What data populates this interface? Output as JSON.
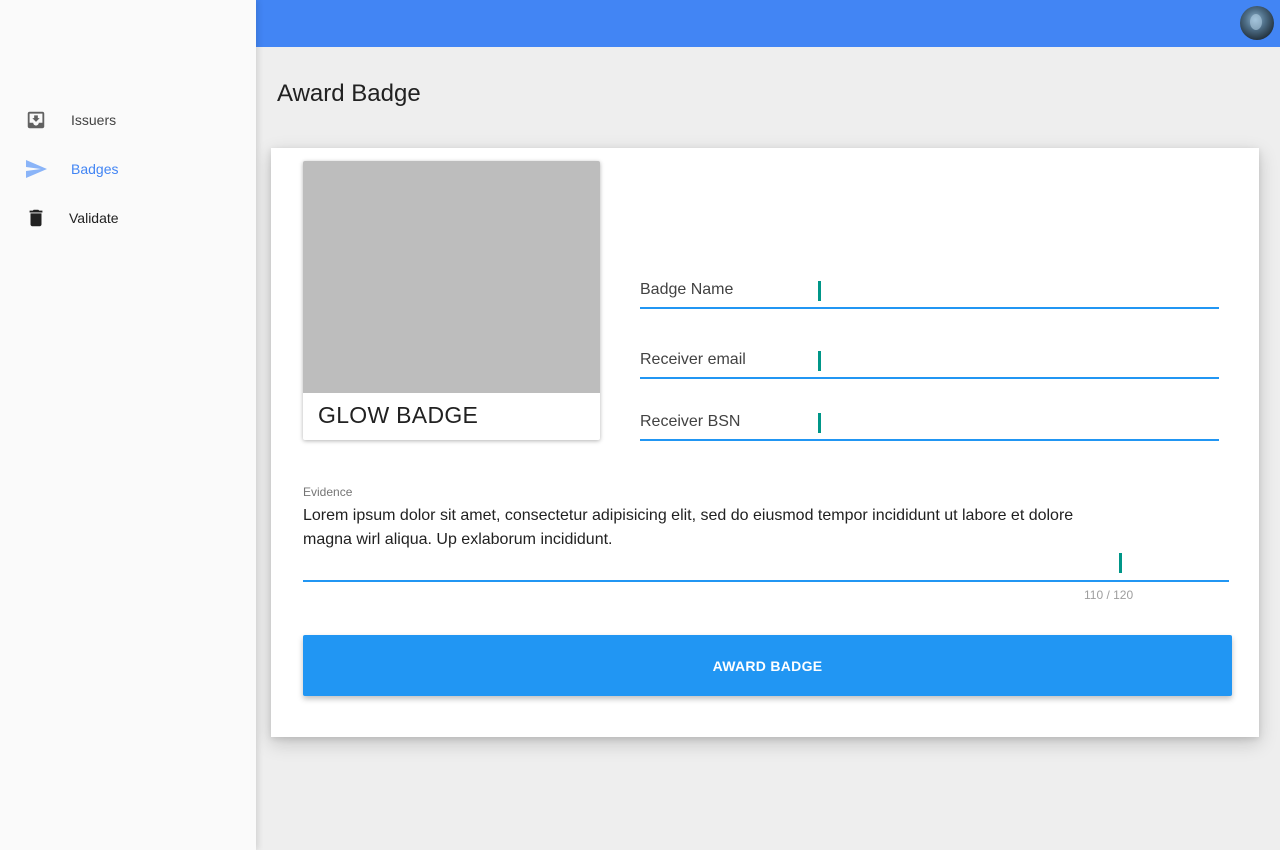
{
  "sidebar": {
    "items": [
      {
        "label": "Issuers",
        "icon": "inbox-icon"
      },
      {
        "label": "Badges",
        "icon": "send-icon",
        "active": true
      },
      {
        "label": "Validate",
        "icon": "trash-icon"
      }
    ]
  },
  "topbar": {
    "color": "#4285f4",
    "avatar_icon": "user-avatar"
  },
  "page": {
    "title": "Award Badge"
  },
  "badge": {
    "name": "GLOW BADGE"
  },
  "form": {
    "badge_name_label": "Badge Name",
    "badge_name_value": "",
    "receiver_email_label": "Receiver email",
    "receiver_email_value": "",
    "receiver_bsn_label": "Receiver BSN",
    "receiver_bsn_value": "",
    "evidence_label": "Evidence",
    "evidence_value": "Lorem ipsum dolor sit amet, consectetur adipisicing elit, sed do eiusmod tempor incididunt ut labore et dolore magna wirl aliqua. Up exlaborum incididunt.",
    "evidence_counter": "110 / 120",
    "submit_label": "AWARD BADGE"
  },
  "colors": {
    "accent": "#2196f3",
    "caret": "#009688",
    "active_nav": "#4285f4"
  }
}
